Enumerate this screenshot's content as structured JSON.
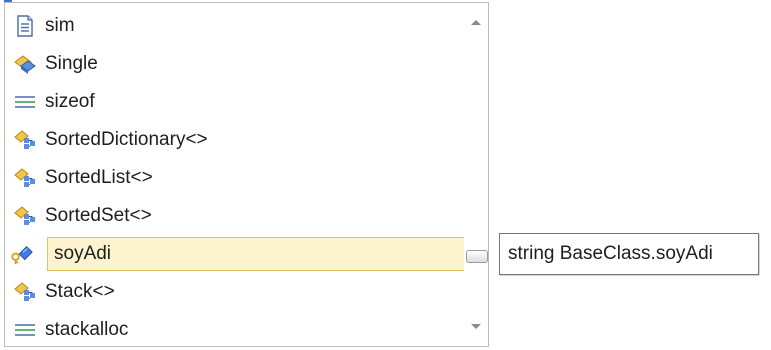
{
  "completion": {
    "items": [
      {
        "label": "sim",
        "icon": "document-icon"
      },
      {
        "label": "Single",
        "icon": "struct-icon"
      },
      {
        "label": "sizeof",
        "icon": "keyword-icon"
      },
      {
        "label": "SortedDictionary<>",
        "icon": "generic-class-icon"
      },
      {
        "label": "SortedList<>",
        "icon": "generic-class-icon"
      },
      {
        "label": "SortedSet<>",
        "icon": "generic-class-icon"
      },
      {
        "label": "soyAdi",
        "icon": "protected-field-icon",
        "selected": true
      },
      {
        "label": "Stack<>",
        "icon": "generic-class-icon"
      },
      {
        "label": "stackalloc",
        "icon": "keyword-icon"
      }
    ]
  },
  "tooltip": {
    "text": "string BaseClass.soyAdi"
  },
  "colors": {
    "selection_bg": "#fdf4cf",
    "selection_border": "#e5c365",
    "tooltip_border": "#767676"
  }
}
